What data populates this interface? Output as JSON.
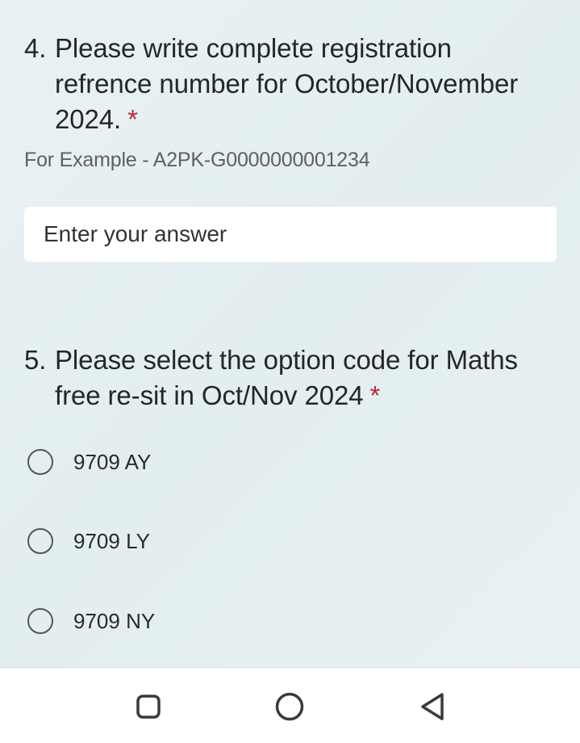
{
  "questions": [
    {
      "number": "4.",
      "text": "Please write complete registration refrence number for October/November 2024.",
      "required_mark": "*",
      "hint": "For Example - A2PK-G0000000001234",
      "input_placeholder": "Enter your answer"
    },
    {
      "number": "5.",
      "text": "Please select the option code for Maths free re-sit in Oct/Nov 2024",
      "required_mark": "*",
      "options": [
        {
          "label": "9709 AY",
          "selected": false
        },
        {
          "label": "9709 LY",
          "selected": false
        },
        {
          "label": "9709 NY",
          "selected": false
        }
      ]
    }
  ],
  "navbar": {
    "items": [
      "recent-apps-icon",
      "home-icon",
      "back-icon"
    ]
  },
  "colors": {
    "background": "#e6f0f2",
    "required": "#c4262e",
    "input_bg": "#ffffff",
    "navbar_bg": "#ffffff"
  }
}
